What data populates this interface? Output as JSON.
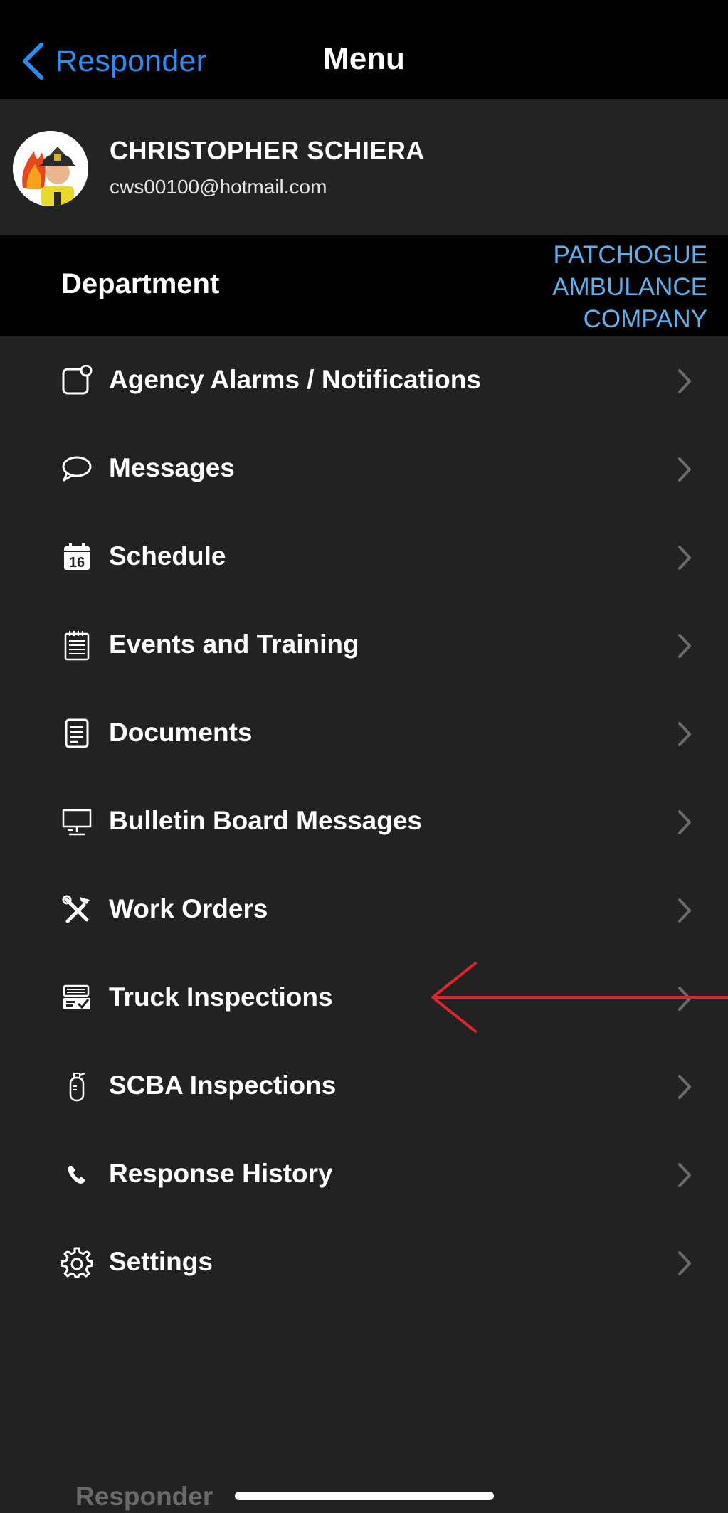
{
  "navbar": {
    "back_label": "Responder",
    "title": "Menu"
  },
  "profile": {
    "name": "CHRISTOPHER SCHIERA",
    "email": "cws00100@hotmail.com"
  },
  "department": {
    "label": "Department",
    "line1": "PATCHOGUE",
    "line2": "AMBULANCE",
    "line3": "COMPANY"
  },
  "menu": {
    "items": [
      {
        "label": "Agency Alarms / Notifications",
        "icon": "notification-icon"
      },
      {
        "label": "Messages",
        "icon": "chat-bubble-icon"
      },
      {
        "label": "Schedule",
        "icon": "calendar-icon"
      },
      {
        "label": "Events and Training",
        "icon": "notepad-icon"
      },
      {
        "label": "Documents",
        "icon": "document-icon"
      },
      {
        "label": "Bulletin Board Messages",
        "icon": "monitor-icon"
      },
      {
        "label": "Work Orders",
        "icon": "tools-icon"
      },
      {
        "label": "Truck Inspections",
        "icon": "truck-inspection-icon"
      },
      {
        "label": "SCBA Inspections",
        "icon": "air-tank-icon"
      },
      {
        "label": "Response History",
        "icon": "phone-icon"
      },
      {
        "label": "Settings",
        "icon": "gear-icon"
      }
    ]
  },
  "calendar_day": "16",
  "bottom_label": "Responder",
  "colors": {
    "accent": "#2d8cf0",
    "department_value": "#5cb0ec",
    "annotation_arrow": "#e0242a",
    "background": "#222222"
  }
}
